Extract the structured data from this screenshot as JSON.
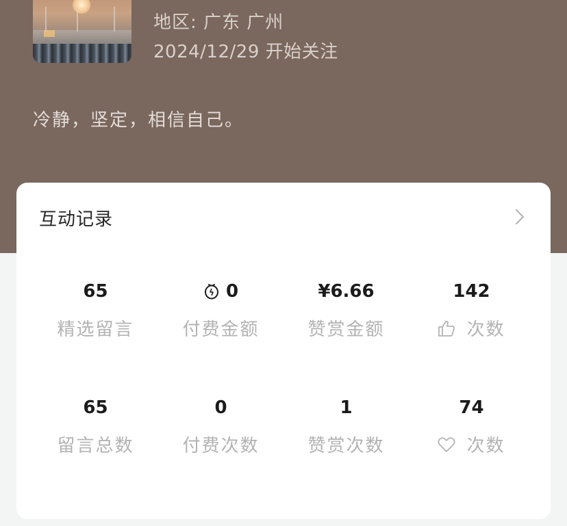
{
  "profile": {
    "region": "地区: 广东 广州",
    "follow_since": "2024/12/29 开始关注",
    "signature": "冷静，坚定，相信自己。"
  },
  "interaction": {
    "title": "互动记录",
    "stats": [
      {
        "value": "65",
        "label": "精选留言"
      },
      {
        "value": "0",
        "value_icon": "coin-icon",
        "label": "付费金额"
      },
      {
        "value": "¥6.66",
        "label": "赞赏金额"
      },
      {
        "value": "142",
        "label_icon": "like-icon",
        "label": "次数"
      },
      {
        "value": "65",
        "label": "留言总数"
      },
      {
        "value": "0",
        "label": "付费次数"
      },
      {
        "value": "1",
        "label": "赞赏次数"
      },
      {
        "value": "74",
        "label_icon": "heart-icon",
        "label": "次数"
      }
    ]
  },
  "colors": {
    "header_bg": "#7a675e",
    "card_bg": "#ffffff",
    "value_text": "#1b1b1b",
    "label_text": "#b3b3b3"
  }
}
